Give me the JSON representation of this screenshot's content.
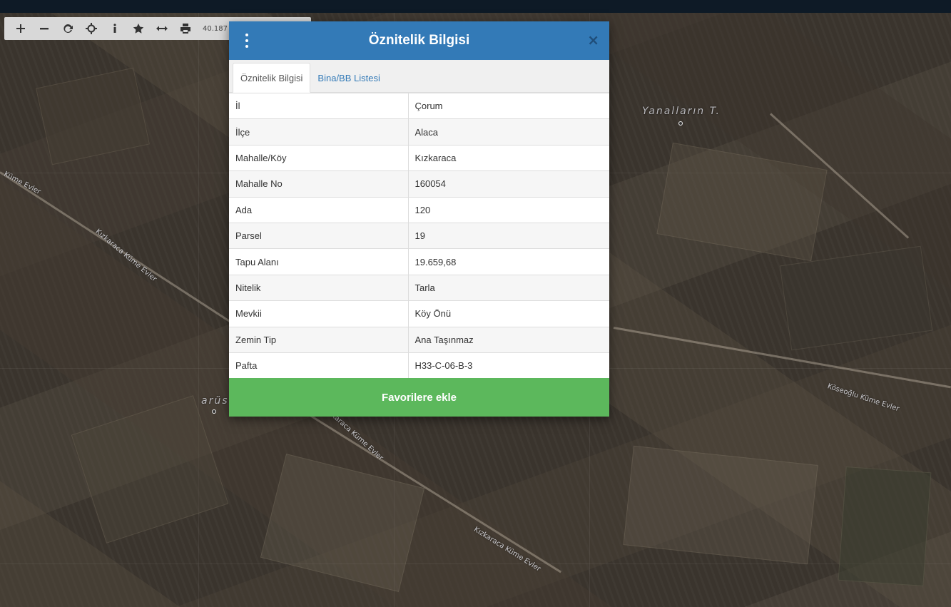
{
  "toolbar": {
    "tools": [
      {
        "icon": "plus-icon",
        "glyph": "+"
      },
      {
        "icon": "minus-icon",
        "glyph": "−"
      },
      {
        "icon": "refresh-icon",
        "glyph": "⟳"
      },
      {
        "icon": "crosshair-icon",
        "glyph": "⌖"
      },
      {
        "icon": "info-icon",
        "glyph": "i"
      },
      {
        "icon": "star-icon",
        "glyph": "★"
      },
      {
        "icon": "measure-icon",
        "glyph": "↔"
      },
      {
        "icon": "print-icon",
        "glyph": "⎙"
      }
    ],
    "coordinate": "40.187"
  },
  "map_labels": {
    "yanallarin": "Yanalların T.",
    "kume_evler_left": "Küme Evler",
    "kizkaraca_1": "Kızkaraca Küme Evler",
    "kizkaraca_2": "Kızkaraca Küme Evler",
    "kizkaraca_3": "Kızkaraca Küme Evler",
    "koseoglu": "Köseoğlu Küme Evler",
    "arus": "arüs"
  },
  "modal": {
    "title": "Öznitelik Bilgisi",
    "close_glyph": "×",
    "tabs": [
      {
        "label": "Öznitelik Bilgisi",
        "active": true
      },
      {
        "label": "Bina/BB Listesi",
        "active": false
      }
    ],
    "rows": [
      {
        "key": "İl",
        "value": "Çorum"
      },
      {
        "key": "İlçe",
        "value": "Alaca"
      },
      {
        "key": "Mahalle/Köy",
        "value": "Kızkaraca"
      },
      {
        "key": "Mahalle No",
        "value": "160054"
      },
      {
        "key": "Ada",
        "value": "120"
      },
      {
        "key": "Parsel",
        "value": "19"
      },
      {
        "key": "Tapu Alanı",
        "value": "19.659,68"
      },
      {
        "key": "Nitelik",
        "value": "Tarla"
      },
      {
        "key": "Mevkii",
        "value": "Köy Önü"
      },
      {
        "key": "Zemin Tip",
        "value": "Ana Taşınmaz"
      },
      {
        "key": "Pafta",
        "value": "H33-C-06-B-3"
      }
    ],
    "favorite_button": "Favorilere ekle"
  },
  "colors": {
    "header_blue": "#337ab7",
    "button_green": "#5cb85c",
    "topbar": "#0e1a26"
  }
}
